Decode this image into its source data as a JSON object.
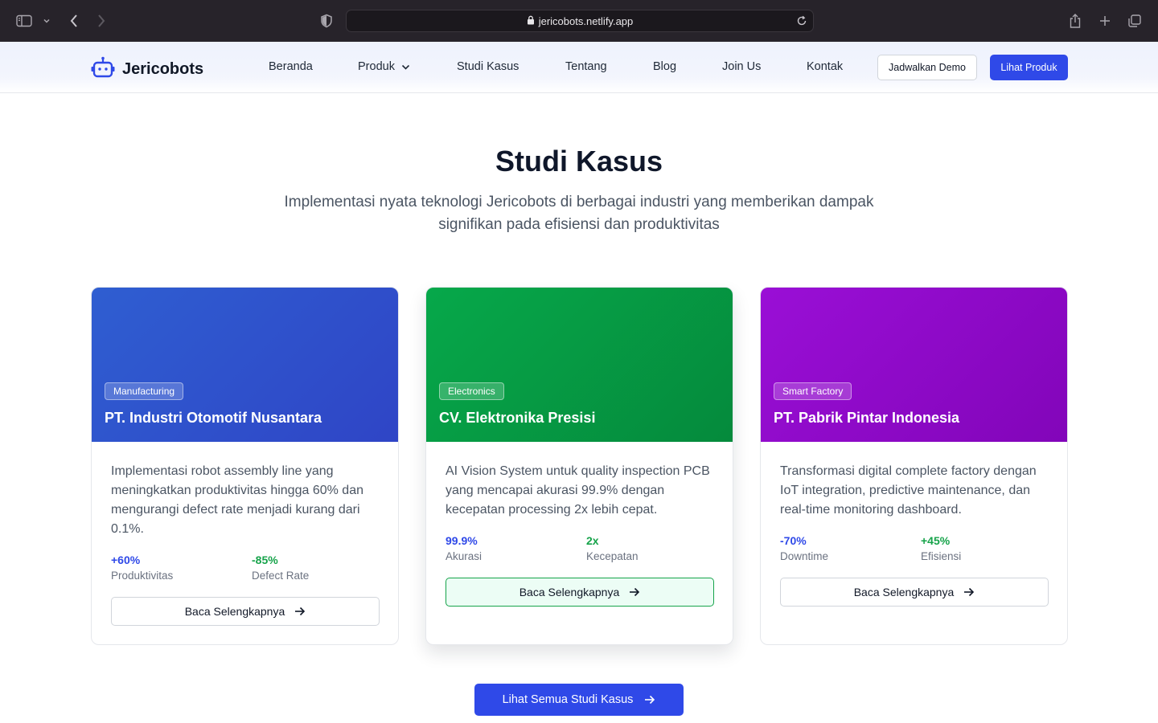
{
  "browser": {
    "url": "jericobots.netlify.app"
  },
  "nav": {
    "brand": "Jericobots",
    "links": [
      "Beranda",
      "Produk",
      "Studi Kasus",
      "Tentang",
      "Blog",
      "Join Us",
      "Kontak"
    ],
    "demo_button": "Jadwalkan Demo",
    "product_button": "Lihat Produk"
  },
  "section": {
    "title": "Studi Kasus",
    "subtitle": "Implementasi nyata teknologi Jericobots di berbagai industri yang memberikan dampak signifikan pada efisiensi dan produktivitas"
  },
  "cards": [
    {
      "tag": "Manufacturing",
      "title": "PT. Industri Otomotif Nusantara",
      "description": "Implementasi robot assembly line yang meningkatkan produktivitas hingga 60% dan mengurangi defect rate menjadi kurang dari 0.1%.",
      "stats": [
        {
          "value": "+60%",
          "label": "Produktivitas",
          "color": "#2f49e8"
        },
        {
          "value": "-85%",
          "label": "Defect Rate",
          "color": "#16a34a"
        }
      ],
      "button": "Baca Selengkapnya",
      "gradient_from": "#2f5ed1",
      "gradient_to": "#2f45c6"
    },
    {
      "tag": "Electronics",
      "title": "CV. Elektronika Presisi",
      "description": "AI Vision System untuk quality inspection PCB yang mencapai akurasi 99.9% dengan kecepatan processing 2x lebih cepat.",
      "stats": [
        {
          "value": "99.9%",
          "label": "Akurasi",
          "color": "#2f49e8"
        },
        {
          "value": "2x",
          "label": "Kecepatan",
          "color": "#16a34a"
        }
      ],
      "button": "Baca Selengkapnya",
      "gradient_from": "#06a84a",
      "gradient_to": "#058a3c"
    },
    {
      "tag": "Smart Factory",
      "title": "PT. Pabrik Pintar Indonesia",
      "description": "Transformasi digital complete factory dengan IoT integration, predictive maintenance, dan real-time monitoring dashboard.",
      "stats": [
        {
          "value": "-70%",
          "label": "Downtime",
          "color": "#2f49e8"
        },
        {
          "value": "+45%",
          "label": "Efisiensi",
          "color": "#16a34a"
        }
      ],
      "button": "Baca Selengkapnya",
      "gradient_from": "#9a0fd6",
      "gradient_to": "#8205b9"
    }
  ],
  "all_button": "Lihat Semua Studi Kasus"
}
